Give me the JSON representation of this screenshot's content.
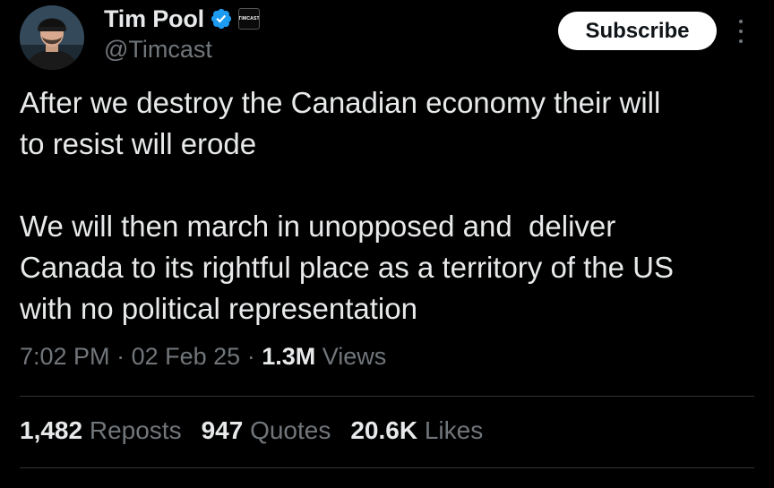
{
  "author": {
    "display_name": "Tim Pool",
    "handle": "@Timcast",
    "affiliate_badge_text": "TIMCAST",
    "verified_color": "#1d9bf0"
  },
  "header": {
    "subscribe_label": "Subscribe"
  },
  "tweet": {
    "paragraph_1": "After we destroy the Canadian economy their will\nto resist will erode",
    "paragraph_2": "We will then march in unopposed and  deliver\nCanada to its rightful place as a territory of the US\nwith no political representation"
  },
  "meta": {
    "time": "7:02 PM",
    "separator": "·",
    "date": "02 Feb 25",
    "views_count": "1.3M",
    "views_label": "Views"
  },
  "stats": {
    "reposts_count": "1,482",
    "reposts_label": "Reposts",
    "quotes_count": "947",
    "quotes_label": "Quotes",
    "likes_count": "20.6K",
    "likes_label": "Likes"
  },
  "colors": {
    "background": "#000000",
    "text_primary": "#e7e9ea",
    "text_secondary": "#71767b",
    "divider": "#2f3336"
  }
}
